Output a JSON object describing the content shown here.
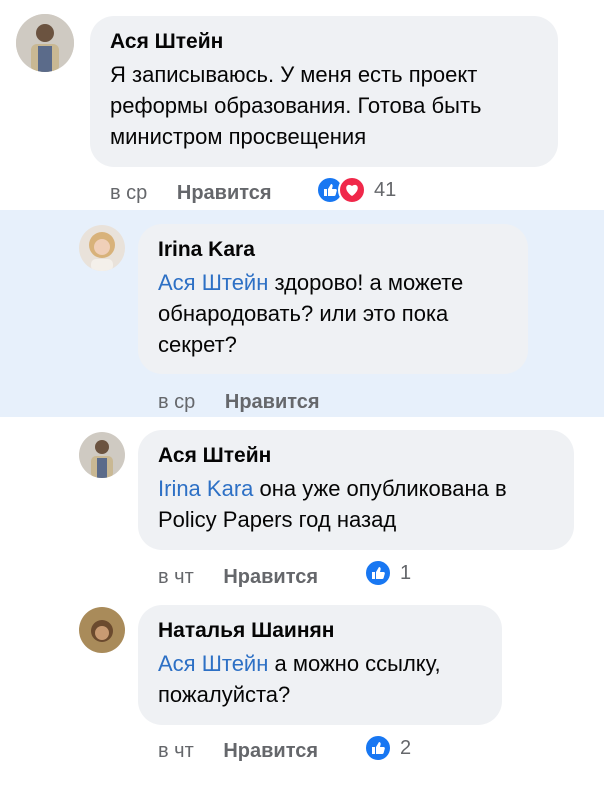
{
  "comments": [
    {
      "author": "Ася Штейн",
      "text": "Я записываюсь. У меня есть проект реформы образования. Готова быть министром просвещения",
      "time": "в ср",
      "like_label": "Нравится",
      "reactions": [
        "like",
        "love"
      ],
      "reaction_count": "41"
    },
    {
      "author": "Irina Kara",
      "mention": "Ася Штейн",
      "text": " здорово! а можете обнародовать? или это пока секрет?",
      "time": "в ср",
      "like_label": "Нравится"
    },
    {
      "author": "Ася Штейн",
      "mention": "Irina Kara",
      "text": " она уже опубликована в Policy Papers год назад",
      "time": "в чт",
      "like_label": "Нравится",
      "reactions": [
        "like"
      ],
      "reaction_count": "1"
    },
    {
      "author": "Наталья Шаинян",
      "mention": "Ася Штейн",
      "text": " а можно ссылку, пожалуйста?",
      "time": "в чт",
      "like_label": "Нравится",
      "reactions": [
        "like"
      ],
      "reaction_count": "2"
    }
  ],
  "colors": {
    "mention": "#2d70c5",
    "like_reaction": "#1877f2",
    "love_reaction": "#f0284a",
    "highlight": "#e7f0fb",
    "bubble": "#eff1f4"
  }
}
